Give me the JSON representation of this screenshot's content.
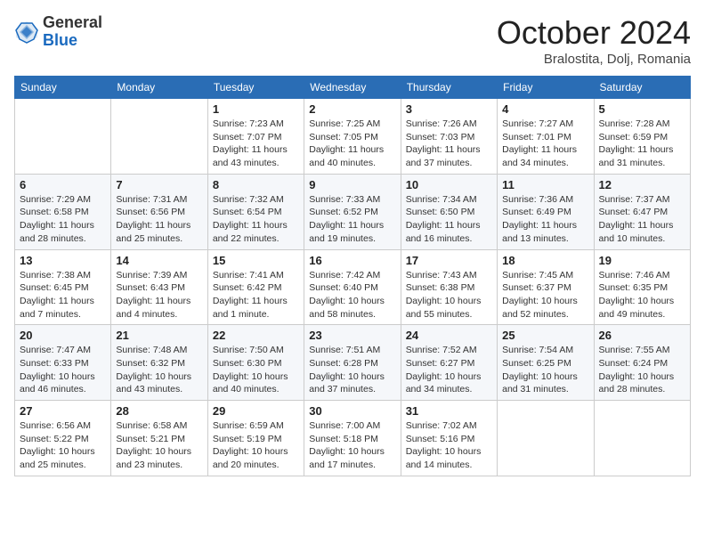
{
  "header": {
    "logo": {
      "line1": "General",
      "line2": "Blue"
    },
    "title": "October 2024",
    "subtitle": "Bralostita, Dolj, Romania"
  },
  "weekdays": [
    "Sunday",
    "Monday",
    "Tuesday",
    "Wednesday",
    "Thursday",
    "Friday",
    "Saturday"
  ],
  "weeks": [
    [
      {
        "day": "",
        "info": ""
      },
      {
        "day": "",
        "info": ""
      },
      {
        "day": "1",
        "info": "Sunrise: 7:23 AM\nSunset: 7:07 PM\nDaylight: 11 hours and 43 minutes."
      },
      {
        "day": "2",
        "info": "Sunrise: 7:25 AM\nSunset: 7:05 PM\nDaylight: 11 hours and 40 minutes."
      },
      {
        "day": "3",
        "info": "Sunrise: 7:26 AM\nSunset: 7:03 PM\nDaylight: 11 hours and 37 minutes."
      },
      {
        "day": "4",
        "info": "Sunrise: 7:27 AM\nSunset: 7:01 PM\nDaylight: 11 hours and 34 minutes."
      },
      {
        "day": "5",
        "info": "Sunrise: 7:28 AM\nSunset: 6:59 PM\nDaylight: 11 hours and 31 minutes."
      }
    ],
    [
      {
        "day": "6",
        "info": "Sunrise: 7:29 AM\nSunset: 6:58 PM\nDaylight: 11 hours and 28 minutes."
      },
      {
        "day": "7",
        "info": "Sunrise: 7:31 AM\nSunset: 6:56 PM\nDaylight: 11 hours and 25 minutes."
      },
      {
        "day": "8",
        "info": "Sunrise: 7:32 AM\nSunset: 6:54 PM\nDaylight: 11 hours and 22 minutes."
      },
      {
        "day": "9",
        "info": "Sunrise: 7:33 AM\nSunset: 6:52 PM\nDaylight: 11 hours and 19 minutes."
      },
      {
        "day": "10",
        "info": "Sunrise: 7:34 AM\nSunset: 6:50 PM\nDaylight: 11 hours and 16 minutes."
      },
      {
        "day": "11",
        "info": "Sunrise: 7:36 AM\nSunset: 6:49 PM\nDaylight: 11 hours and 13 minutes."
      },
      {
        "day": "12",
        "info": "Sunrise: 7:37 AM\nSunset: 6:47 PM\nDaylight: 11 hours and 10 minutes."
      }
    ],
    [
      {
        "day": "13",
        "info": "Sunrise: 7:38 AM\nSunset: 6:45 PM\nDaylight: 11 hours and 7 minutes."
      },
      {
        "day": "14",
        "info": "Sunrise: 7:39 AM\nSunset: 6:43 PM\nDaylight: 11 hours and 4 minutes."
      },
      {
        "day": "15",
        "info": "Sunrise: 7:41 AM\nSunset: 6:42 PM\nDaylight: 11 hours and 1 minute."
      },
      {
        "day": "16",
        "info": "Sunrise: 7:42 AM\nSunset: 6:40 PM\nDaylight: 10 hours and 58 minutes."
      },
      {
        "day": "17",
        "info": "Sunrise: 7:43 AM\nSunset: 6:38 PM\nDaylight: 10 hours and 55 minutes."
      },
      {
        "day": "18",
        "info": "Sunrise: 7:45 AM\nSunset: 6:37 PM\nDaylight: 10 hours and 52 minutes."
      },
      {
        "day": "19",
        "info": "Sunrise: 7:46 AM\nSunset: 6:35 PM\nDaylight: 10 hours and 49 minutes."
      }
    ],
    [
      {
        "day": "20",
        "info": "Sunrise: 7:47 AM\nSunset: 6:33 PM\nDaylight: 10 hours and 46 minutes."
      },
      {
        "day": "21",
        "info": "Sunrise: 7:48 AM\nSunset: 6:32 PM\nDaylight: 10 hours and 43 minutes."
      },
      {
        "day": "22",
        "info": "Sunrise: 7:50 AM\nSunset: 6:30 PM\nDaylight: 10 hours and 40 minutes."
      },
      {
        "day": "23",
        "info": "Sunrise: 7:51 AM\nSunset: 6:28 PM\nDaylight: 10 hours and 37 minutes."
      },
      {
        "day": "24",
        "info": "Sunrise: 7:52 AM\nSunset: 6:27 PM\nDaylight: 10 hours and 34 minutes."
      },
      {
        "day": "25",
        "info": "Sunrise: 7:54 AM\nSunset: 6:25 PM\nDaylight: 10 hours and 31 minutes."
      },
      {
        "day": "26",
        "info": "Sunrise: 7:55 AM\nSunset: 6:24 PM\nDaylight: 10 hours and 28 minutes."
      }
    ],
    [
      {
        "day": "27",
        "info": "Sunrise: 6:56 AM\nSunset: 5:22 PM\nDaylight: 10 hours and 25 minutes."
      },
      {
        "day": "28",
        "info": "Sunrise: 6:58 AM\nSunset: 5:21 PM\nDaylight: 10 hours and 23 minutes."
      },
      {
        "day": "29",
        "info": "Sunrise: 6:59 AM\nSunset: 5:19 PM\nDaylight: 10 hours and 20 minutes."
      },
      {
        "day": "30",
        "info": "Sunrise: 7:00 AM\nSunset: 5:18 PM\nDaylight: 10 hours and 17 minutes."
      },
      {
        "day": "31",
        "info": "Sunrise: 7:02 AM\nSunset: 5:16 PM\nDaylight: 10 hours and 14 minutes."
      },
      {
        "day": "",
        "info": ""
      },
      {
        "day": "",
        "info": ""
      }
    ]
  ]
}
